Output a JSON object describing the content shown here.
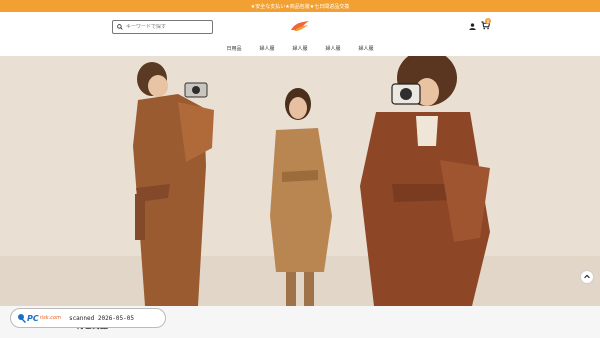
{
  "topbar": {
    "announcement": "★安全な支払い★商品包装★七日間返品交換"
  },
  "header": {
    "search_placeholder": "キーワードで探す",
    "cart_count": "0"
  },
  "nav": {
    "items": [
      "日用品",
      "婦人服",
      "婦人服",
      "婦人服",
      "婦人服"
    ]
  },
  "hero": {
    "scene": "three-models-camel-coats"
  },
  "watermark": {
    "brand": "PC",
    "brand_sub": "risk.com",
    "stamp": "scanned 2026-05-05"
  },
  "section": {
    "title": "特色商品"
  },
  "colors": {
    "accent": "#f3a033",
    "hero_bg": "#e7ddd1"
  },
  "icons": [
    "search-icon",
    "user-icon",
    "cart-icon",
    "scroll-up-icon",
    "logo-icon"
  ]
}
